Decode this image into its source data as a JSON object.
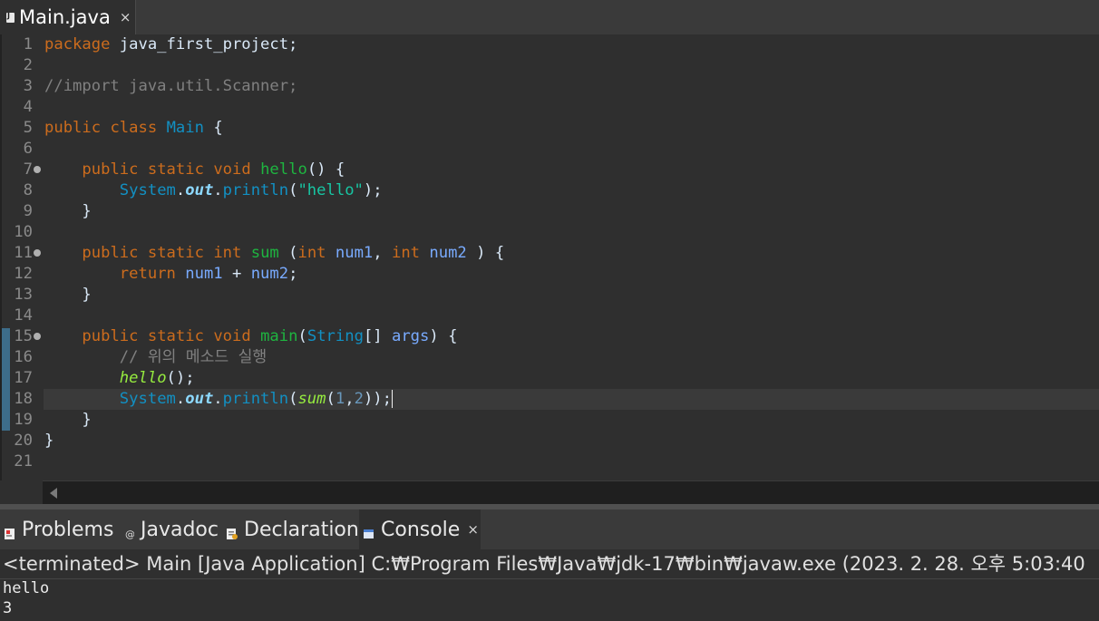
{
  "editor_tab": {
    "title": "Main.java",
    "close": "×"
  },
  "code_lines": [
    "package java_first_project;",
    "",
    "//import java.util.Scanner;",
    "",
    "public class Main {",
    "",
    "    public static void hello() {",
    "        System.out.println(\"hello\");",
    "    }",
    "",
    "    public static int sum (int num1, int num2 ) {",
    "        return num1 + num2;",
    "    }",
    "",
    "    public static void main(String[] args) {",
    "        // 위의 메소드 실행",
    "        hello();",
    "        System.out.println(sum(1,2));",
    "    }",
    "}",
    ""
  ],
  "line_numbers": [
    "1",
    "2",
    "3",
    "4",
    "5",
    "6",
    "7",
    "8",
    "9",
    "10",
    "11",
    "12",
    "13",
    "14",
    "15",
    "16",
    "17",
    "18",
    "19",
    "20",
    "21"
  ],
  "view_tabs": [
    {
      "label": "Problems",
      "icon": "problems-icon"
    },
    {
      "label": "Javadoc",
      "icon": "javadoc-icon"
    },
    {
      "label": "Declaration",
      "icon": "declaration-icon"
    },
    {
      "label": "Console",
      "icon": "console-icon",
      "active": true
    }
  ],
  "view_tab_close": "×",
  "console": {
    "header": "<terminated> Main [Java Application] C:₩Program Files₩Java₩jdk-17₩bin₩javaw.exe  (2023. 2. 28. 오후 5:03:40",
    "output": [
      "hello",
      "3"
    ]
  }
}
